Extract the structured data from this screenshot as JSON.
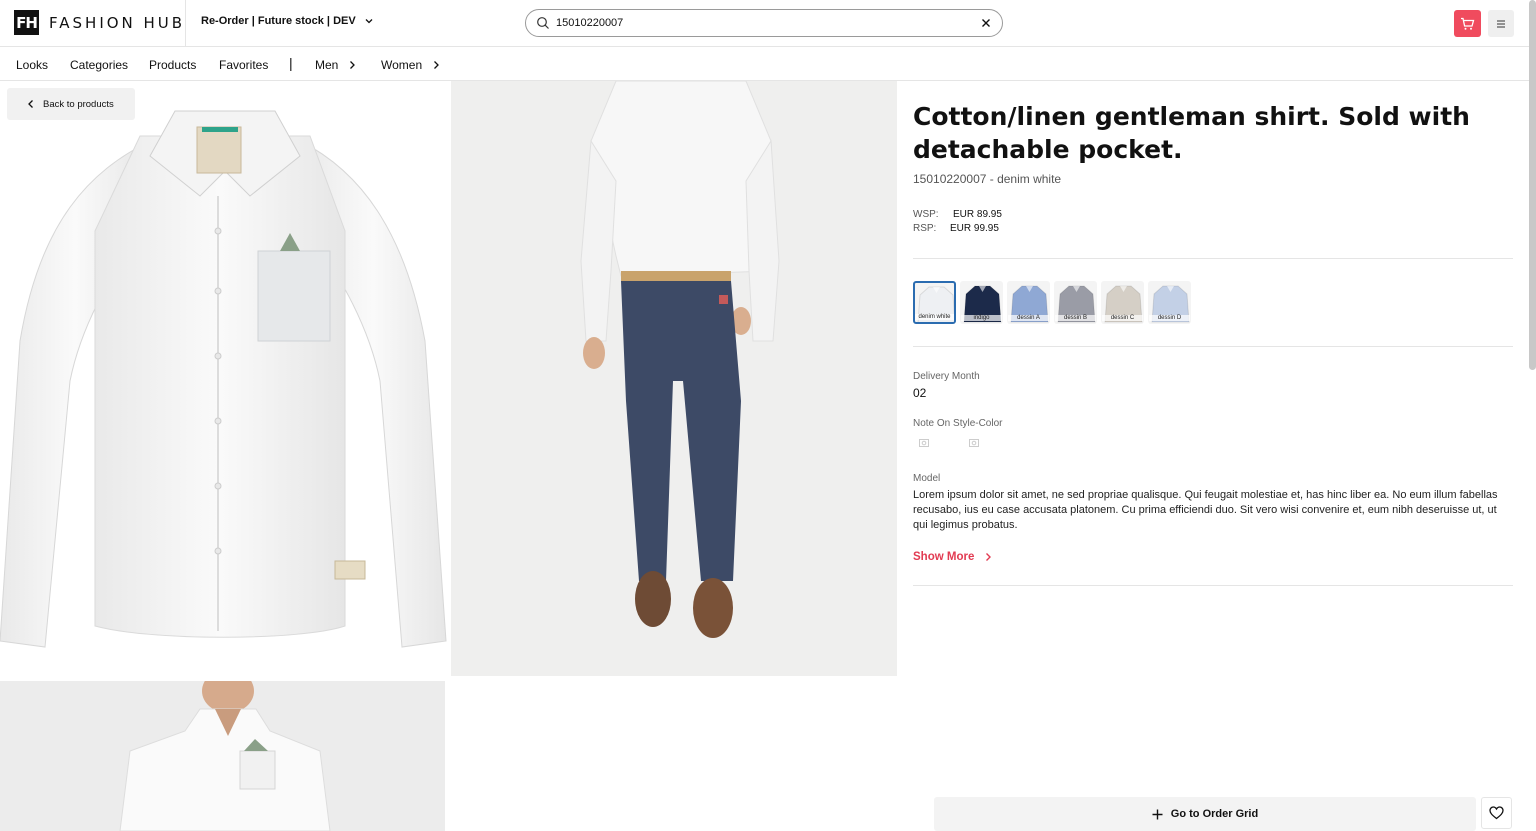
{
  "header": {
    "logo_mark": "FH",
    "logo_text": "FASHION HUB",
    "context_label": "Re-Order | Future stock | DEV",
    "search": {
      "value": "15010220007",
      "placeholder": ""
    }
  },
  "nav": {
    "items": [
      "Looks",
      "Categories",
      "Products",
      "Favorites"
    ],
    "separator": "|",
    "men": "Men",
    "women": "Women"
  },
  "back_label": "Back to products",
  "product": {
    "title": "Cotton/linen gentleman shirt. Sold with detachable pocket.",
    "subtitle": "15010220007 - denim white",
    "wsp_label": "WSP:",
    "wsp_value": "EUR 89.95",
    "rsp_label": "RSP:",
    "rsp_value": "EUR 99.95",
    "swatches": [
      {
        "label": "denim white",
        "color": "#eef0f3",
        "selected": true
      },
      {
        "label": "indigo",
        "color": "#1c2a4a",
        "selected": false
      },
      {
        "label": "dessin A",
        "color": "#8fa8d4",
        "selected": false
      },
      {
        "label": "dessin B",
        "color": "#9a9ca6",
        "selected": false
      },
      {
        "label": "dessin C",
        "color": "#d5cfc6",
        "selected": false
      },
      {
        "label": "dessin D",
        "color": "#c3d0e6",
        "selected": false
      }
    ],
    "delivery_label": "Delivery Month",
    "delivery_value": "02",
    "note_label": "Note On Style-Color",
    "model_label": "Model",
    "model_text": "Lorem ipsum dolor sit amet, ne sed propriae qualisque. Qui feugait molestiae et, has hinc liber ea. No eum illum fabellas recusabo, ius eu case accusata platonem. Cu prima efficiendi duo. Sit vero wisi convenire et, eum nibh deseruisse ut, ut qui legimus probatus.",
    "show_more": "Show More"
  },
  "order_grid_label": "Go to Order Grid",
  "colors": {
    "accent": "#e23b52",
    "cart": "#f04b5e",
    "selected_border": "#2b6cb0"
  }
}
